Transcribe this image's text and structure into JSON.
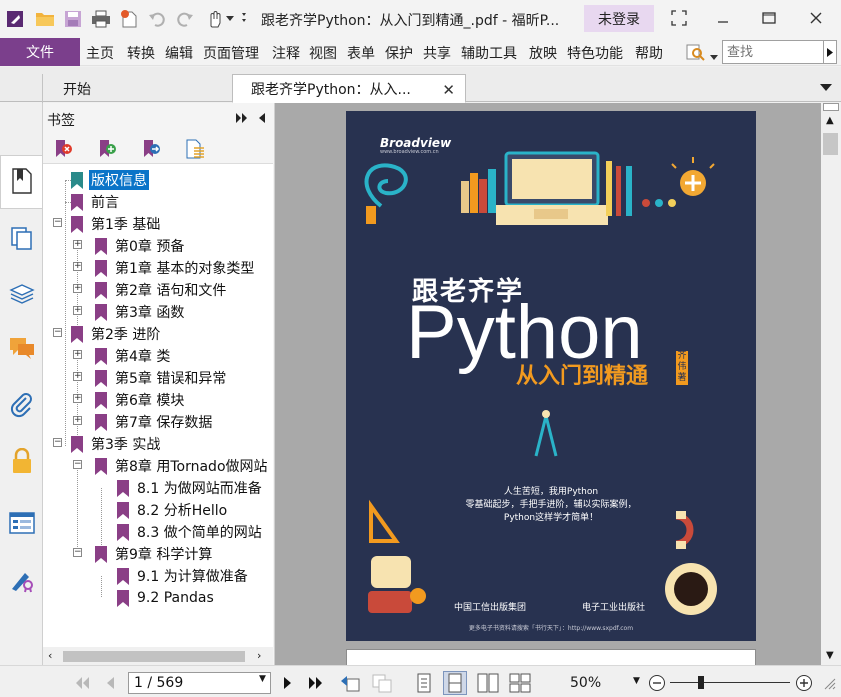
{
  "window": {
    "title": "跟老齐学Python：从入门到精通_.pdf - 福昕P...",
    "login_label": "未登录"
  },
  "menu": {
    "file_label": "文件",
    "items": [
      "主页",
      "转换",
      "编辑",
      "页面管理",
      "注释",
      "视图",
      "表单",
      "保护",
      "共享",
      "辅助工具",
      "放映",
      "特色功能",
      "帮助"
    ],
    "search_placeholder": "查找"
  },
  "tabs": [
    {
      "label": "开始"
    },
    {
      "label": "跟老齐学Python：从入..."
    }
  ],
  "bookmarks": {
    "panel_title": "书签",
    "items": [
      {
        "label": "版权信息",
        "selected": true
      },
      {
        "label": "前言"
      },
      {
        "label": "第1季 基础"
      },
      {
        "label": "第0章 预备"
      },
      {
        "label": "第1章 基本的对象类型"
      },
      {
        "label": "第2章 语句和文件"
      },
      {
        "label": "第3章 函数"
      },
      {
        "label": "第2季 进阶"
      },
      {
        "label": "第4章 类"
      },
      {
        "label": "第5章 错误和异常"
      },
      {
        "label": "第6章 模块"
      },
      {
        "label": "第7章 保存数据"
      },
      {
        "label": "第3季 实战"
      },
      {
        "label": "第8章 用Tornado做网站"
      },
      {
        "label": "8.1 为做网站而准备"
      },
      {
        "label": "8.2 分析Hello"
      },
      {
        "label": "8.3 做个简单的网站"
      },
      {
        "label": "第9章 科学计算"
      },
      {
        "label": "9.1 为计算做准备"
      },
      {
        "label": "9.2 Pandas"
      }
    ]
  },
  "cover": {
    "publisher_logo": "Broadview",
    "publisher_url": "www.broadview.com.cn",
    "title_cn": "跟老齐学",
    "title_en": "Python",
    "subtitle": "从入门到精通",
    "author": "齐伟 著",
    "slogan": [
      "人生苦短，我用Python",
      "零基础起步，手把手进阶，辅以实际案例，",
      "Python这样学才简单！"
    ],
    "group_name": "中国工信出版集团",
    "press_name": "电子工业出版社",
    "footer": "更多电子书资料请搜索「书行天下」：http://www.sxpdf.com"
  },
  "status": {
    "page_indicator": "1 / 569",
    "zoom": "50%"
  },
  "colors": {
    "accent_purple": "#7b3f8c",
    "login_bg": "#e8d8f0",
    "bookmark_flag": "#8a3f86",
    "bookmark_flag_first": "#2a8a8a",
    "selection": "#0b74c8",
    "cover_bg": "#283250",
    "subtitle_orange": "#f29a1f"
  }
}
